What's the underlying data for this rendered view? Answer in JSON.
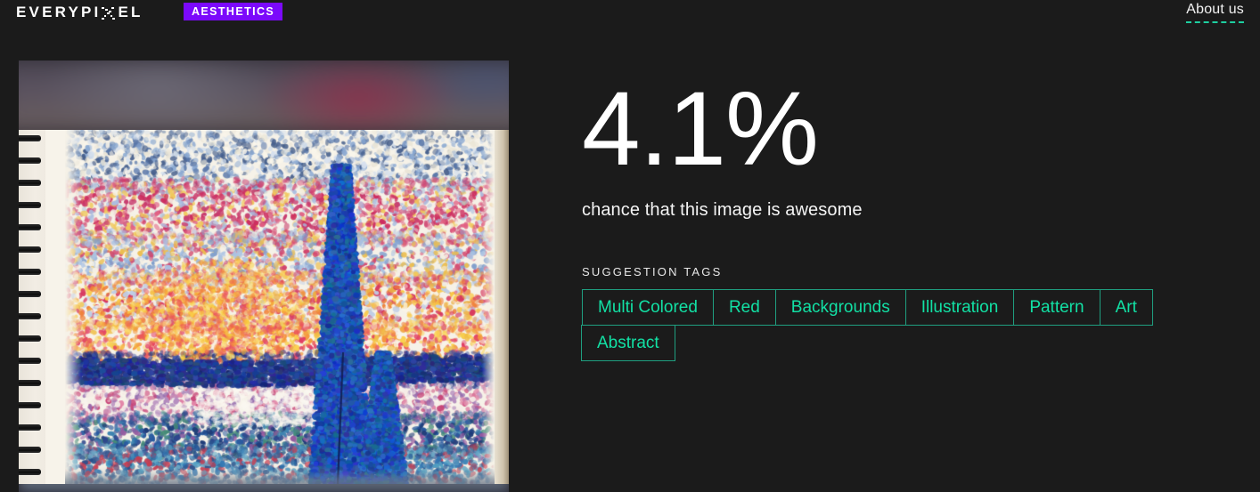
{
  "header": {
    "logo": {
      "text_before_icon": "EVERYPI",
      "icon": "pixel-x-icon",
      "text_after_icon": "EL",
      "full_text": "EVERYPIXEL"
    },
    "badge_label": "AESTHETICS",
    "about_link": "About us",
    "badge_color": "#7b09fb",
    "accent_color": "#12e0a4"
  },
  "preview": {
    "alt": "pointillist painting in a spiral notebook",
    "icon": "image-preview"
  },
  "results": {
    "score": "4.1%",
    "score_value": 4.1,
    "score_caption": "chance that this image is awesome",
    "tags_label": "SUGGESTION TAGS",
    "tags": [
      {
        "label": "Multi Colored"
      },
      {
        "label": "Red"
      },
      {
        "label": "Backgrounds"
      },
      {
        "label": "Illustration"
      },
      {
        "label": "Pattern"
      },
      {
        "label": "Art"
      },
      {
        "label": "Abstract"
      }
    ]
  }
}
